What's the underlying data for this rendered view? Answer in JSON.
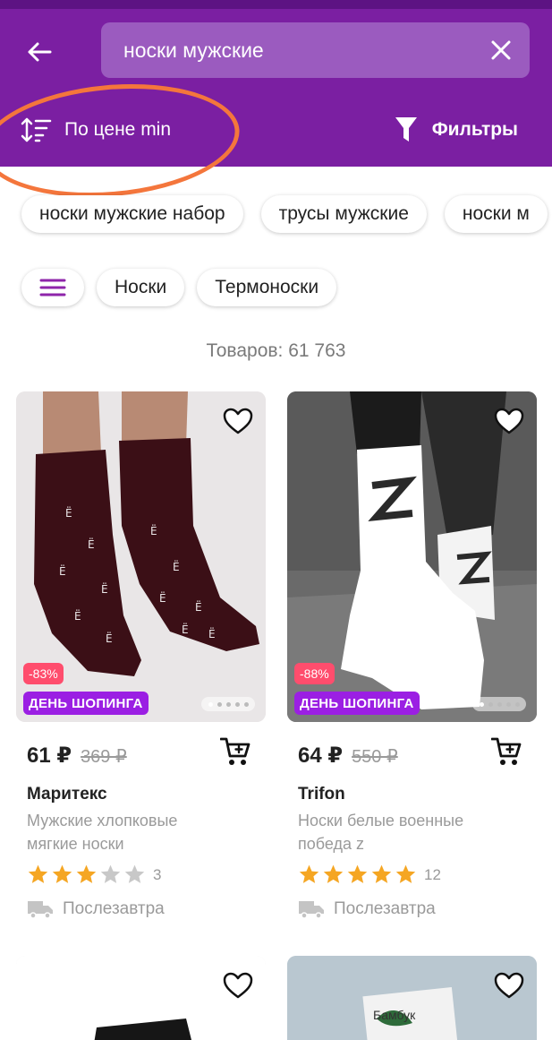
{
  "header": {
    "search": {
      "value": "носки мужские"
    },
    "sort_label": "По цене min",
    "filter_label": "Фильтры"
  },
  "suggestions": [
    "носки мужские набор",
    "трусы мужские",
    "носки м"
  ],
  "categories": [
    "Носки",
    "Термоноски"
  ],
  "results_count": "Товаров: 61 763",
  "products": [
    {
      "discount": "-83%",
      "promo": "ДЕНЬ ШОПИНГА",
      "price": "61 ₽",
      "old_price": "369 ₽",
      "brand": "Маритекс",
      "desc_line1": "Мужские хлопковые",
      "desc_line2": "мягкие носки",
      "rating": 3,
      "reviews": "3",
      "delivery": "Послезавтра"
    },
    {
      "discount": "-88%",
      "promo": "ДЕНЬ ШОПИНГА",
      "price": "64 ₽",
      "old_price": "550 ₽",
      "brand": "Trifon",
      "desc_line1": "Носки белые военные",
      "desc_line2": "победа z",
      "rating": 5,
      "reviews": "12",
      "delivery": "Послезавтра"
    }
  ],
  "next_products": [
    {
      "image_text": ""
    },
    {
      "image_text": "Бамбук"
    }
  ],
  "colors": {
    "header": "#7b1fa2",
    "search_bg": "#9b5bbf",
    "discount": "#ff4d6d",
    "promo": "#9b1fe3",
    "star": "#f5a623",
    "annotation": "#f4763c"
  },
  "icons": {
    "back": "arrow-left-icon",
    "clear": "close-icon",
    "sort": "sort-icon",
    "filter": "funnel-icon",
    "favorite": "heart-icon",
    "cart": "cart-icon",
    "delivery": "truck-icon",
    "star": "star-icon",
    "menu": "menu-icon"
  }
}
